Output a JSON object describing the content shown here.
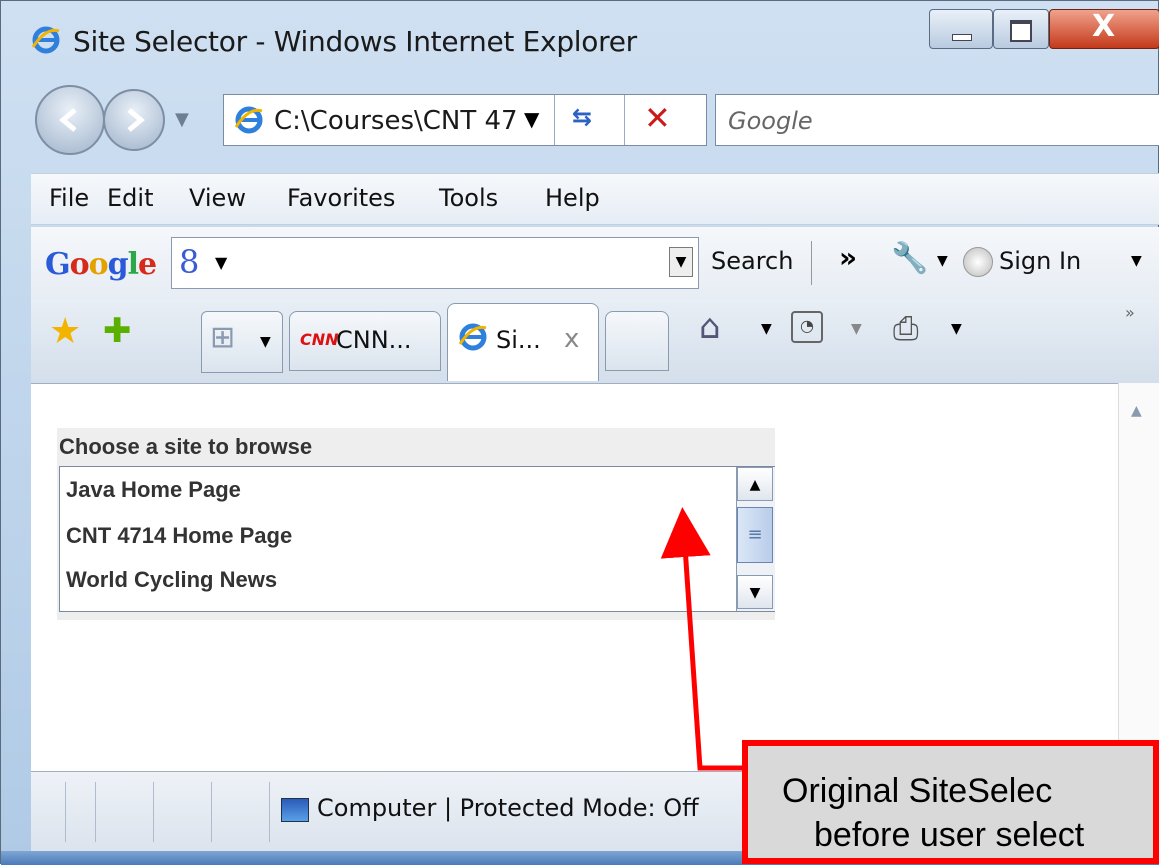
{
  "window": {
    "title": "Site Selector - Windows Internet Explorer"
  },
  "navigation": {
    "address": "C:\\Courses\\CNT 47",
    "search_placeholder": "Google"
  },
  "menu": {
    "items": [
      "File",
      "Edit",
      "View",
      "Favorites",
      "Tools",
      "Help"
    ]
  },
  "google_toolbar": {
    "logo": "Google",
    "g_icon": "8",
    "search_label": "Search",
    "more_label": "»",
    "signin_label": "Sign In"
  },
  "tabs": {
    "items": [
      {
        "icon": "cnn-logo",
        "logo_text": "CNN",
        "label": "CNN..."
      },
      {
        "icon": "ie-icon",
        "label": "Si...",
        "close": "x"
      }
    ]
  },
  "applet": {
    "label": "Choose a site to browse",
    "items": [
      "Java Home Page",
      "CNT 4714 Home Page",
      "World Cycling News"
    ]
  },
  "status": {
    "text": "Computer | Protected Mode: Off"
  },
  "callout": {
    "line1": "Original SiteSelec",
    "line2": "before user select"
  },
  "colors": {
    "callout_border": "#ff0000",
    "callout_bg": "#d9d9d9",
    "arrow": "#ff0000"
  }
}
